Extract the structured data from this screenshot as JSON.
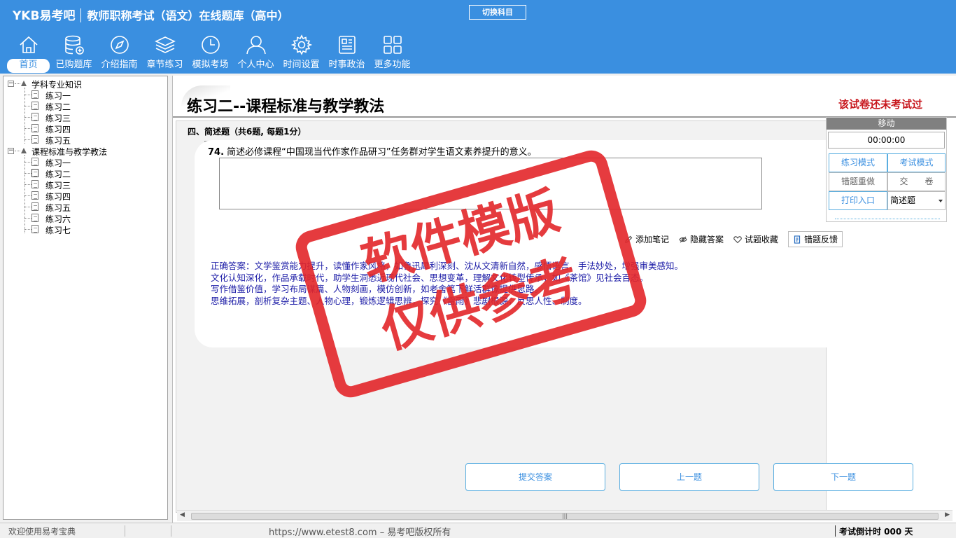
{
  "header": {
    "logo": "YKB易考吧",
    "title": "教师职称考试（语文）在线题库（高中）",
    "switch_subject": "切换科目"
  },
  "nav": [
    {
      "label": "首页",
      "icon": "home-icon"
    },
    {
      "label": "已购题库",
      "icon": "database-icon"
    },
    {
      "label": "介绍指南",
      "icon": "compass-icon"
    },
    {
      "label": "章节练习",
      "icon": "layers-icon"
    },
    {
      "label": "模拟考场",
      "icon": "clock-icon"
    },
    {
      "label": "个人中心",
      "icon": "user-icon"
    },
    {
      "label": "时间设置",
      "icon": "gear-icon"
    },
    {
      "label": "时事政治",
      "icon": "news-icon"
    },
    {
      "label": "更多功能",
      "icon": "grid-icon"
    }
  ],
  "tree": {
    "group1": {
      "label": "学科专业知识",
      "items": [
        "练习一",
        "练习二",
        "练习三",
        "练习四",
        "练习五"
      ]
    },
    "group2": {
      "label": "课程标准与教学教法",
      "items": [
        "练习一",
        "练习二",
        "练习三",
        "练习四",
        "练习五",
        "练习六",
        "练习七"
      ]
    }
  },
  "paper": {
    "title": "练习二--课程标准与教学教法",
    "status": "该试卷还未考试过",
    "section": "四、简述题（共6题, 每题1分）",
    "question_no": "74.",
    "question": "简述必修课程“中国现当代作家作品研习”任务群对学生语文素养提升的意义。",
    "answer_value": "",
    "tools": {
      "note": "添加笔记",
      "hide_answer": "隐藏答案",
      "favorite": "试题收藏",
      "feedback": "错题反馈"
    },
    "correct_answer": [
      "正确答案：文学鉴赏能力提升，读懂作家风格，如鲁迅犀利深刻、沈从文清新自然，感悟语言、手法妙处，增强审美感知。",
      "文化认知深化，作品承载时代，助学生洞悉近现代社会、思想变革，理解文化转型传承，如《茶馆》见社会百态。",
      "写作借鉴价值，学习布局谋篇、人物刻画，模仿创新，如老舍笔下鲜活群像提供思路。",
      "思维拓展，剖析复杂主题、人物心理，锻炼逻辑思辨，探究《雷雨》悲剧根源，反思人性、制度。"
    ]
  },
  "buttons": {
    "submit": "提交答案",
    "prev": "上一题",
    "next": "下一题"
  },
  "control": {
    "move": "移动",
    "timer": "00:00:00",
    "practice_mode": "练习模式",
    "exam_mode": "考试模式",
    "redo_wrong": "错题重做",
    "hand_in": "交　　卷",
    "print": "打印入口",
    "type_select": "简述题"
  },
  "watermark": {
    "line1": "软件模版",
    "line2": "仅供参考"
  },
  "status": {
    "welcome": "欢迎使用易考宝典",
    "copyright": "https://www.etest8.com – 易考吧版权所有",
    "countdown": "考试倒计时 000 天"
  },
  "colors": {
    "brand_blue": "#3a8fe0",
    "stamp_red": "#e3262a",
    "status_red": "#c8181e",
    "answer_blue": "#1a1aa6"
  }
}
